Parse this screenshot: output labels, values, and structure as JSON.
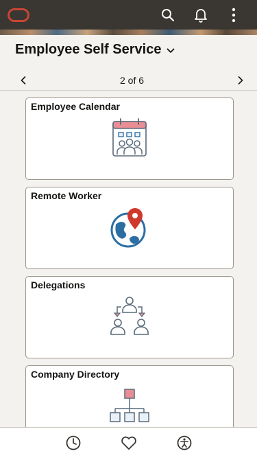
{
  "header": {
    "logo": "oracle-logo",
    "icons": [
      "search-icon",
      "bell-icon",
      "more-vertical-icon"
    ],
    "brand_color": "#c74634",
    "bar_color": "#3a3632"
  },
  "page": {
    "title": "Employee Self Service",
    "pager": "2 of 6"
  },
  "tiles": [
    {
      "title": "Employee Calendar",
      "icon": "calendar-people-icon"
    },
    {
      "title": "Remote Worker",
      "icon": "globe-pin-icon"
    },
    {
      "title": "Delegations",
      "icon": "delegation-icon"
    },
    {
      "title": "Company Directory",
      "icon": "org-chart-icon"
    }
  ],
  "bottom_nav": {
    "icons": [
      "history-icon",
      "favorites-icon",
      "accessibility-icon"
    ]
  }
}
